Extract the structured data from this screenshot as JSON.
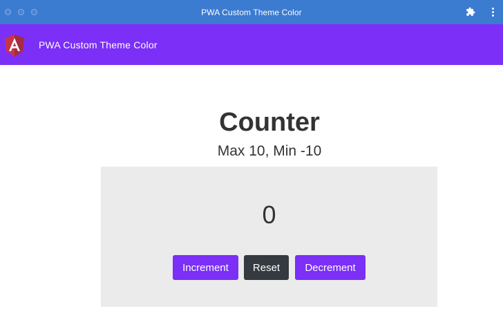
{
  "window": {
    "title": "PWA Custom Theme Color",
    "titlebar_color": "#3b7bd0"
  },
  "toolbar": {
    "app_title": "PWA Custom Theme Color",
    "theme_color": "#7b2ff7",
    "logo_icon": "angular-logo-icon"
  },
  "counter": {
    "heading": "Counter",
    "subheading": "Max 10, Min -10",
    "value": "0",
    "buttons": {
      "increment": "Increment",
      "reset": "Reset",
      "decrement": "Decrement"
    }
  }
}
